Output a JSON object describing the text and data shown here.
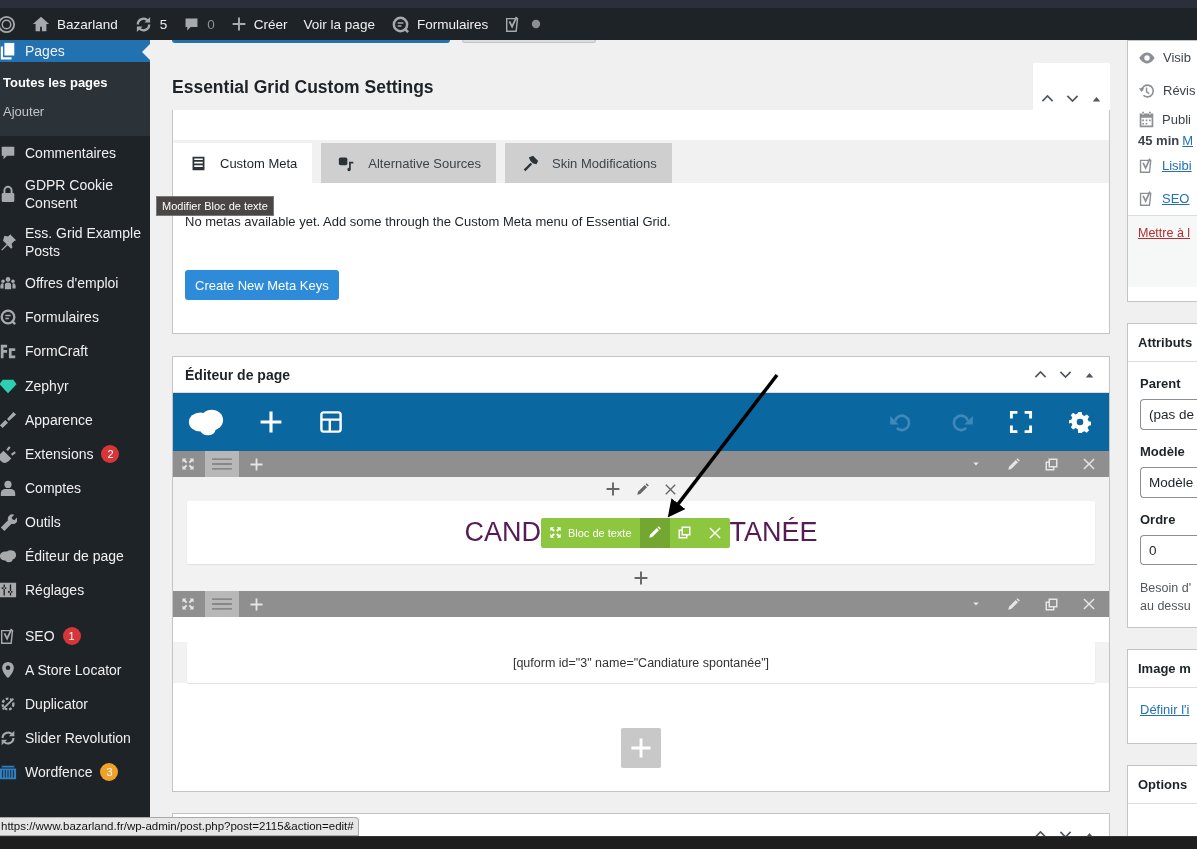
{
  "top_bar": {
    "site": "Bazarland",
    "updates": "5",
    "comments": "0",
    "new": "Créer",
    "view": "Voir la page",
    "forms": "Formulaires"
  },
  "sidebar": {
    "groups": [
      [
        {
          "label": "Pages",
          "selected": true,
          "children": [
            {
              "label": "Toutes les pages",
              "selected": true
            },
            {
              "label": "Ajouter",
              "selected": false
            }
          ]
        },
        {
          "label": "Commentaires",
          "selected": false
        },
        {
          "label": "GDPR Cookie Consent",
          "selected": false
        },
        {
          "label": "Ess. Grid Example Posts",
          "selected": false
        },
        {
          "label": "Offres d'emploi",
          "selected": false
        },
        {
          "label": "Formulaires",
          "selected": false
        },
        {
          "label": "FormCraft",
          "selected": false
        }
      ],
      [
        {
          "label": "Zephyr",
          "selected": false
        },
        {
          "label": "Apparence",
          "selected": false
        },
        {
          "label": "Extensions",
          "selected": false,
          "badge": "2",
          "color": "#d63638"
        },
        {
          "label": "Comptes",
          "selected": false
        },
        {
          "label": "Outils",
          "selected": false
        },
        {
          "label": "Éditeur de page",
          "selected": false
        },
        {
          "label": "Réglages",
          "selected": false
        }
      ],
      [
        {
          "label": "SEO",
          "selected": false,
          "badge": "1",
          "color": "#d63638"
        },
        {
          "label": "A Store Locator",
          "selected": false
        },
        {
          "label": "Duplicator",
          "selected": false
        },
        {
          "label": "Slider Revolution",
          "selected": false
        },
        {
          "label": "Wordfence",
          "selected": false,
          "badge": "3",
          "color": "#f0a12a"
        }
      ]
    ]
  },
  "eg_settings": {
    "title": "Essential Grid Custom Settings",
    "tabs": [
      {
        "label": "Custom Meta",
        "selected": true
      },
      {
        "label": "Alternative Sources",
        "selected": false
      },
      {
        "label": "Skin Modifications",
        "selected": false
      }
    ],
    "message": "No metas available yet. Add some through the Custom Meta menu of Essential Grid.",
    "button": "Create New Meta Keys"
  },
  "page_editor": {
    "title": "Éditeur de page",
    "rows": [
      {
        "kind": "text",
        "text_start": "CAND",
        "text_end": "TANÉE",
        "module_label": "Bloc de texte"
      },
      {
        "kind": "shortcode",
        "text": "[quform id=\"3\" name=\"Candiature spontanée\"]"
      }
    ]
  },
  "publish": {
    "visibility": "Visib",
    "revisions": "Révis",
    "published": "Publi",
    "published_time": "45 min",
    "published_link": "M",
    "readability_link": "Lisibi",
    "seo_link": "SEO",
    "update_link": "Mettre à l"
  },
  "attributes": {
    "title": "Attributs",
    "parent_label": "Parent",
    "parent_value": "(pas de",
    "template_label": "Modèle",
    "template_value": "Modèle",
    "order_label": "Ordre",
    "order_value": "0",
    "help_lines": [
      "Besoin d'",
      "au dessu"
    ]
  },
  "featured_image": {
    "title": "Image m",
    "link": "Définir l'i"
  },
  "options": {
    "title": "Options"
  },
  "tooltip": "Modifier Bloc de texte",
  "status_url": "https://www.bazarland.fr/wp-admin/post.php?post=2115&action=edit#"
}
